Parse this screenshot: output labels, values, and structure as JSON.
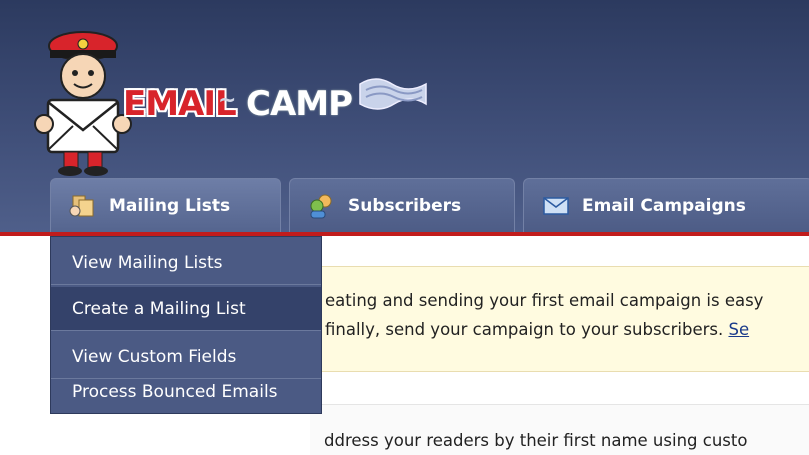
{
  "logo": {
    "word1": "EMAIL",
    "connector": "~",
    "word2": "CAMP"
  },
  "tabs": [
    {
      "label": "Mailing Lists",
      "icon": "mailing-lists-icon"
    },
    {
      "label": "Subscribers",
      "icon": "subscribers-icon"
    },
    {
      "label": "Email Campaigns",
      "icon": "envelope-icon"
    }
  ],
  "dropdown": {
    "items": [
      {
        "label": "View Mailing Lists"
      },
      {
        "label": "Create a Mailing List"
      },
      {
        "label": "View Custom Fields"
      },
      {
        "label": "Process Bounced Emails"
      }
    ]
  },
  "notices": {
    "line1": "eating and sending your first email campaign is easy",
    "line2": "finally, send your campaign to your subscribers. ",
    "line2_link": "Se",
    "line3": "ddress your readers by their first name using custo"
  },
  "colors": {
    "header": "#3f4e78",
    "accent": "#c11c1c",
    "notice": "#fffbe0"
  }
}
